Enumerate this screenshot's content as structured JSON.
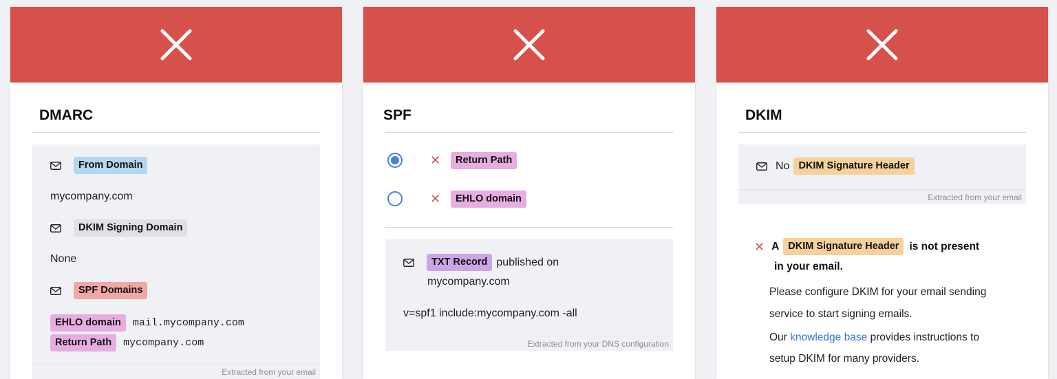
{
  "colors": {
    "banner": "#d6504c",
    "fail_x": "#d6504c",
    "radio": "#4a7fe0",
    "link": "#3a76d8",
    "tag_blue": "#b3d7f0",
    "tag_gray": "#e0e1e4",
    "tag_red": "#f0a7a5",
    "tag_pink": "#e6aee0",
    "tag_purple": "#cda4e8",
    "tag_orange": "#f6d19b"
  },
  "dmarc": {
    "title": "DMARC",
    "status_icon": "close-icon",
    "from_domain_label": "From Domain",
    "from_domain_value": "mycompany.com",
    "dkim_signing_label": "DKIM Signing Domain",
    "dkim_signing_value": "None",
    "spf_domains_label": "SPF Domains",
    "ehlo_label": "EHLO domain",
    "ehlo_value": "mail.mycompany.com",
    "return_path_label": "Return Path",
    "return_path_value": "mycompany.com",
    "footer": "Extracted from your email"
  },
  "spf": {
    "title": "SPF",
    "status_icon": "close-icon",
    "options": [
      {
        "label": "Return Path",
        "selected": true,
        "status": "fail"
      },
      {
        "label": "EHLO domain",
        "selected": false,
        "status": "fail"
      }
    ],
    "txt_label": "TXT Record",
    "published_on": "published on",
    "domain": "mycompany.com",
    "record": "v=spf1 include:mycompany.com -all",
    "footer": "Extracted from your DNS configuration"
  },
  "dkim": {
    "title": "DKIM",
    "status_icon": "close-icon",
    "no_prefix": "No",
    "header_label": "DKIM Signature Header",
    "footer": "Extracted from your email",
    "error_a": "A",
    "error_suffix": "is not present",
    "error_line2": "in your email.",
    "help_line1": "Please configure DKIM for your email sending",
    "help_line2": "service to start signing emails.",
    "kb_prefix": "Our",
    "kb_link": "knowledge base",
    "kb_suffix": "provides instructions to",
    "help_line4": "setup DKIM for many providers."
  }
}
